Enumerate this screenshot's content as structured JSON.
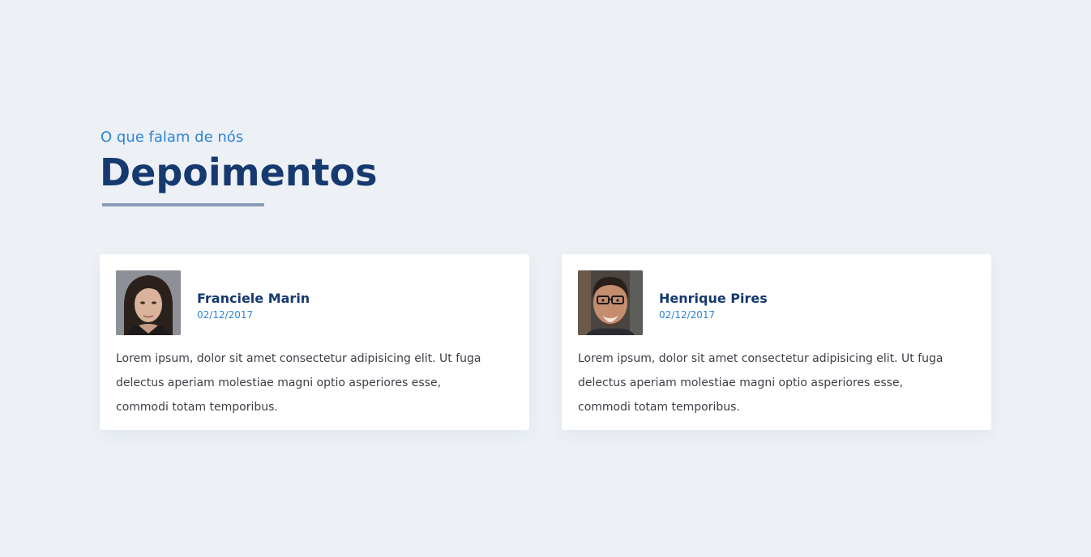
{
  "section": {
    "kicker": "O que falam de nós",
    "title": "Depoimentos"
  },
  "testimonials": [
    {
      "name": "Franciele Marin",
      "date": "02/12/2017",
      "avatar_icon": "woman-portrait-photo",
      "text_lines": [
        "Lorem ipsum, dolor sit amet consectetur adipisicing elit. Ut fuga",
        "delectus aperiam molestiae magni optio asperiores esse,",
        "commodi totam temporibus."
      ]
    },
    {
      "name": "Henrique Pires",
      "date": "02/12/2017",
      "avatar_icon": "man-portrait-photo",
      "text_lines": [
        "Lorem ipsum, dolor sit amet consectetur adipisicing elit. Ut fuga",
        "delectus aperiam molestiae magni optio asperiores esse,",
        "commodi totam temporibus."
      ]
    }
  ],
  "colors": {
    "background": "#edf1f6",
    "accent": "#2b84d8",
    "heading": "#16396f",
    "underline": "#8a9bb8"
  }
}
